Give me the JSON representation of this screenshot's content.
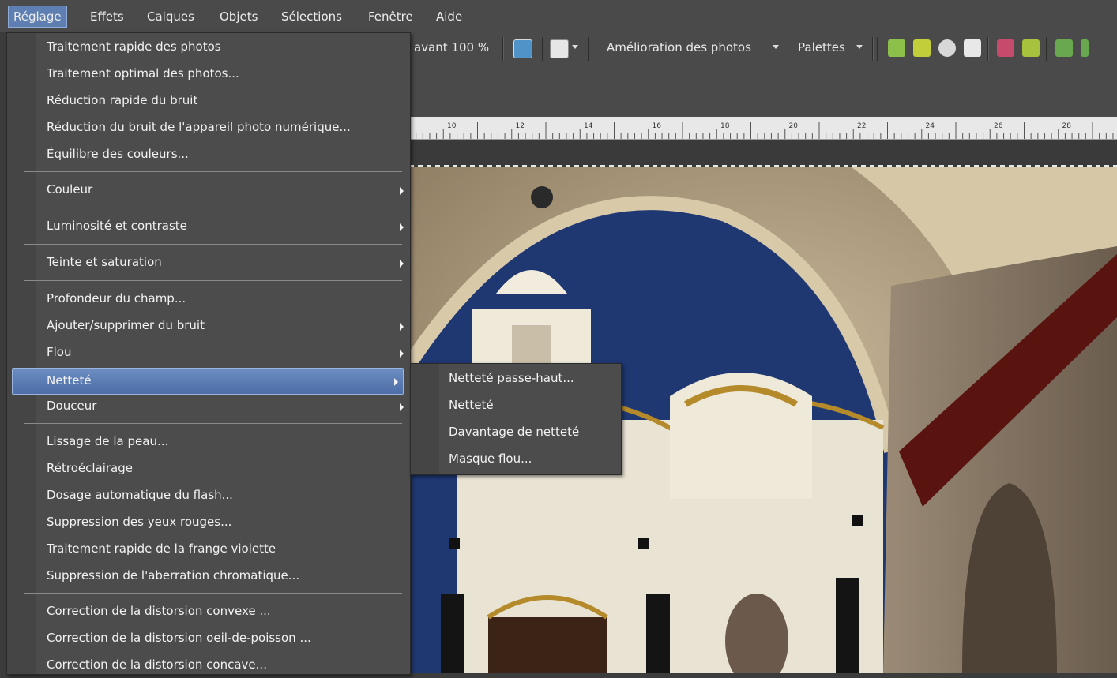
{
  "menubar": {
    "items": [
      {
        "label": "Réglage"
      },
      {
        "label": "Effets"
      },
      {
        "label": "Calques"
      },
      {
        "label": "Objets"
      },
      {
        "label": "Sélections"
      },
      {
        "label": "Fenêtre"
      },
      {
        "label": "Aide"
      }
    ]
  },
  "toolbar": {
    "zoom_label": "avant 100 %",
    "enhance_label": "Amélioration des photos",
    "palettes_label": "Palettes"
  },
  "ruler": {
    "ticks": [
      "10",
      "12",
      "14",
      "16",
      "18",
      "20",
      "22",
      "24",
      "26",
      "28"
    ]
  },
  "menu": {
    "items": [
      {
        "label": "Traitement rapide des photos"
      },
      {
        "label": "Traitement optimal des photos..."
      },
      {
        "label": "Réduction rapide du bruit"
      },
      {
        "label": "Réduction du bruit de l'appareil photo numérique..."
      },
      {
        "label": "Équilibre des couleurs..."
      },
      {
        "label": "Couleur"
      },
      {
        "label": "Luminosité et contraste"
      },
      {
        "label": "Teinte et saturation"
      },
      {
        "label": "Profondeur du champ..."
      },
      {
        "label": "Ajouter/supprimer du bruit"
      },
      {
        "label": "Flou"
      },
      {
        "label": "Netteté"
      },
      {
        "label": "Douceur"
      },
      {
        "label": "Lissage de la peau..."
      },
      {
        "label": "Rétroéclairage"
      },
      {
        "label": "Dosage automatique du flash..."
      },
      {
        "label": "Suppression des yeux rouges..."
      },
      {
        "label": "Traitement rapide de la frange violette"
      },
      {
        "label": "Suppression de l'aberration chromatique..."
      },
      {
        "label": "Correction de la distorsion convexe ..."
      },
      {
        "label": "Correction de la distorsion oeil-de-poisson ..."
      },
      {
        "label": "Correction de la distorsion concave..."
      }
    ]
  },
  "submenu": {
    "items": [
      {
        "label": "Netteté passe-haut..."
      },
      {
        "label": "Netteté"
      },
      {
        "label": "Davantage de netteté"
      },
      {
        "label": "Masque flou..."
      }
    ]
  },
  "colors": {
    "highlight": "#5f7fb3",
    "menu_bg": "#4c4c4c",
    "toolbar_bg": "#4a4a4a"
  }
}
